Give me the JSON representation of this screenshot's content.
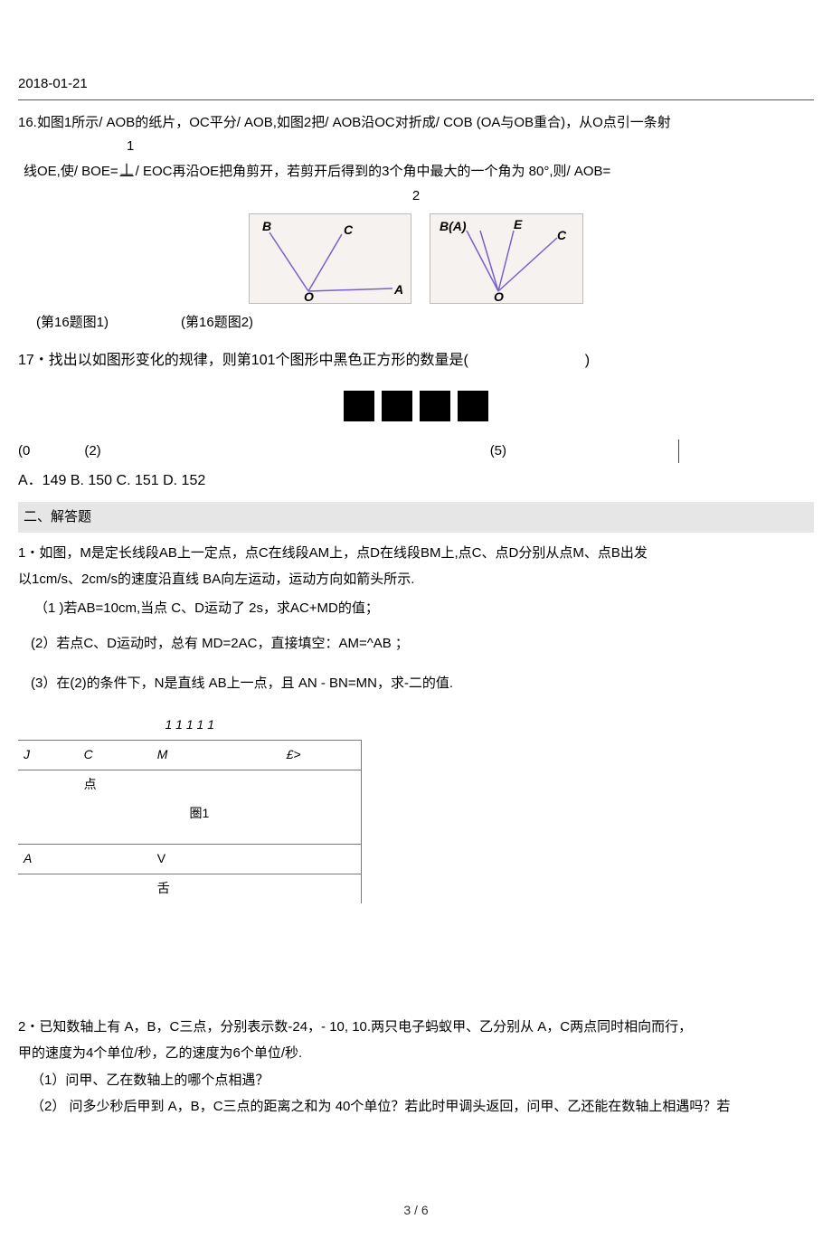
{
  "header": {
    "date": "2018-01-21"
  },
  "q16": {
    "line1_pre": "16.如图1所示/ AOB的纸片，OC平分/ AOB,如图2把/ AOB沿OC对折成/ COB (OA与OB重合)，从O点引一条射",
    "frac_top": "1",
    "line2_a": "线OE,使/ BOE=",
    "line2_perp": "丄",
    "line2_b": "/ EOC再沿OE把角剪开，若剪开后得到的3个角中最大的一个角为 80°,则/ AOB=",
    "frac_bot": "2",
    "caption1": "(第16题图1)",
    "caption2": "(第16题图2)"
  },
  "diagrams": {
    "left": {
      "B": "B",
      "C": "C",
      "O": "O",
      "A": "A"
    },
    "right": {
      "BA": "B(A)",
      "E": "E",
      "C": "C",
      "O": "O"
    }
  },
  "q17": {
    "text": "17・找出以如图形变化的规律，则第101个图形中黑色正方形的数量是(",
    "text_close": ")",
    "nums": {
      "a": "(0",
      "b": "(2)",
      "c": "(5)"
    },
    "choices": "A．149 B. 150 C. 151 D. 152"
  },
  "sectionB": "二、解答题",
  "p1": {
    "l1": "1・如图，M是定长线段AB上一定点，点C在线段AM上，点D在线段BM上,点C、点D分别从点M、点B出发",
    "l2": "以1cm/s、2cm/s的速度沿直线 BA向左运动，运动方向如箭头所示.",
    "s1": "（1 )若AB=10cm,当点 C、D运动了 2s，求AC+MD的值；",
    "s2": "(2）若点C、D运动时，总有 MD=2AC，直接填空：AM=^AB ；",
    "s3": "(3）在(2)的条件下，N是直线 AB上一点，且 AN - BN=MN，求-二的值."
  },
  "table": {
    "r0": "1 1 1 1 1",
    "r1": [
      "J",
      "C",
      "M",
      "",
      "£>"
    ],
    "r1b": "点",
    "r2": "圏1",
    "r3": [
      "A",
      "",
      "V",
      ""
    ],
    "r3b": "舌"
  },
  "p2": {
    "l1": "2・已知数轴上有 A，B，C三点，分别表示数-24，- 10, 10.两只电子蚂蚁甲、乙分别从 A，C两点同时相向而行，",
    "l2": "甲的速度为4个单位/秒，乙的速度为6个单位/秒.",
    "s1": "（1）问甲、乙在数轴上的哪个点相遇？",
    "s2": "（2） 问多少秒后甲到 A，B，C三点的距离之和为 40个单位？若此时甲调头返回，问甲、乙还能在数轴上相遇吗？若"
  },
  "footer": "3 / 6"
}
